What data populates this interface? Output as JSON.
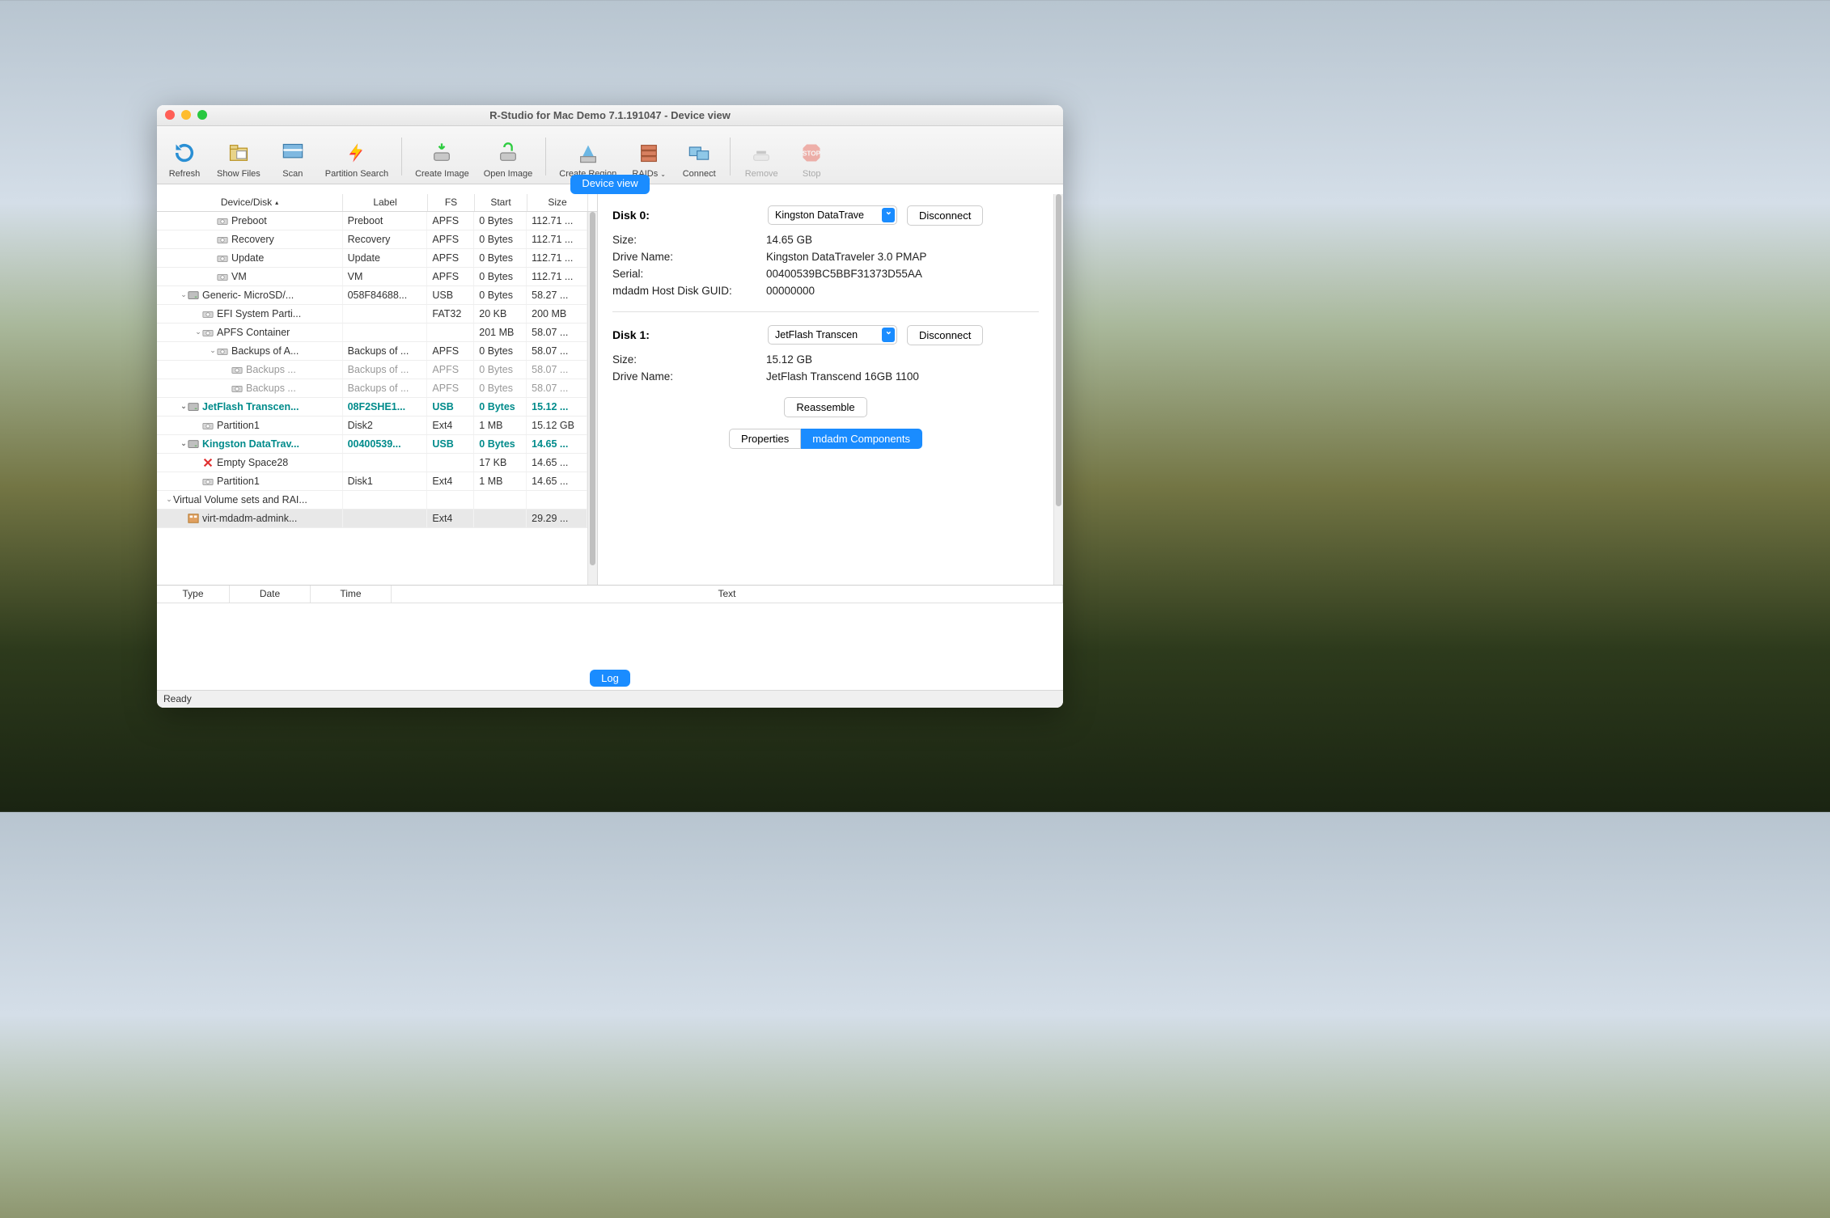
{
  "window": {
    "title": "R-Studio for Mac Demo 7.1.191047 - Device view"
  },
  "toolbar": [
    {
      "id": "refresh",
      "label": "Refresh",
      "icon": "refresh"
    },
    {
      "id": "showfiles",
      "label": "Show Files",
      "icon": "folder"
    },
    {
      "id": "scan",
      "label": "Scan",
      "icon": "scan"
    },
    {
      "id": "partsearch",
      "label": "Partition Search",
      "icon": "lightning"
    },
    {
      "id": "createimage",
      "label": "Create Image",
      "icon": "disk-arrow"
    },
    {
      "id": "openimage",
      "label": "Open Image",
      "icon": "disk-open"
    },
    {
      "id": "createregion",
      "label": "Create Region",
      "icon": "region"
    },
    {
      "id": "raids",
      "label": "RAIDs",
      "icon": "raid",
      "dropdown": true
    },
    {
      "id": "connect",
      "label": "Connect",
      "icon": "monitors"
    },
    {
      "id": "remove",
      "label": "Remove",
      "icon": "minus",
      "disabled": true
    },
    {
      "id": "stop",
      "label": "Stop",
      "icon": "stop",
      "disabled": true
    }
  ],
  "viewtab": "Device view",
  "cols": {
    "device": "Device/Disk",
    "label": "Label",
    "fs": "FS",
    "start": "Start",
    "size": "Size"
  },
  "rows": [
    {
      "indent": 3,
      "icon": "disk",
      "name": "Preboot",
      "label": "Preboot",
      "fs": "APFS",
      "start": "0 Bytes",
      "size": "112.71 ..."
    },
    {
      "indent": 3,
      "icon": "disk",
      "name": "Recovery",
      "label": "Recovery",
      "fs": "APFS",
      "start": "0 Bytes",
      "size": "112.71 ..."
    },
    {
      "indent": 3,
      "icon": "disk",
      "name": "Update",
      "label": "Update",
      "fs": "APFS",
      "start": "0 Bytes",
      "size": "112.71 ..."
    },
    {
      "indent": 3,
      "icon": "disk",
      "name": "VM",
      "label": "VM",
      "fs": "APFS",
      "start": "0 Bytes",
      "size": "112.71 ..."
    },
    {
      "indent": 1,
      "chev": "v",
      "icon": "drive",
      "name": "Generic- MicroSD/...",
      "label": "058F84688...",
      "fs": "USB",
      "start": "0 Bytes",
      "size": "58.27 ..."
    },
    {
      "indent": 2,
      "icon": "disk",
      "name": "EFI System Parti...",
      "label": "",
      "fs": "FAT32",
      "start": "20 KB",
      "size": "200 MB"
    },
    {
      "indent": 2,
      "chev": "v",
      "icon": "disk",
      "name": "APFS Container",
      "label": "",
      "fs": "",
      "start": "201 MB",
      "size": "58.07 ..."
    },
    {
      "indent": 3,
      "chev": "v",
      "icon": "disk",
      "name": "Backups of A...",
      "label": "Backups of ...",
      "fs": "APFS",
      "start": "0 Bytes",
      "size": "58.07 ..."
    },
    {
      "indent": 4,
      "icon": "disk",
      "dim": true,
      "name": "Backups ...",
      "label": "Backups of ...",
      "fs": "APFS",
      "start": "0 Bytes",
      "size": "58.07 ..."
    },
    {
      "indent": 4,
      "icon": "disk",
      "dim": true,
      "name": "Backups ...",
      "label": "Backups of ...",
      "fs": "APFS",
      "start": "0 Bytes",
      "size": "58.07 ..."
    },
    {
      "indent": 1,
      "chev": "v",
      "icon": "drive",
      "bold": true,
      "name": "JetFlash Transcen...",
      "label": "08F2SHE1...",
      "fs": "USB",
      "start": "0 Bytes",
      "size": "15.12 ..."
    },
    {
      "indent": 2,
      "icon": "disk",
      "name": "Partition1",
      "label": "Disk2",
      "fs": "Ext4",
      "start": "1 MB",
      "size": "15.12 GB"
    },
    {
      "indent": 1,
      "chev": "v",
      "icon": "drive",
      "bold": true,
      "name": "Kingston DataTrav...",
      "label": "00400539...",
      "fs": "USB",
      "start": "0 Bytes",
      "size": "14.65 ..."
    },
    {
      "indent": 2,
      "icon": "x",
      "name": "Empty Space28",
      "label": "",
      "fs": "",
      "start": "17 KB",
      "size": "14.65 ..."
    },
    {
      "indent": 2,
      "icon": "disk",
      "name": "Partition1",
      "label": "Disk1",
      "fs": "Ext4",
      "start": "1 MB",
      "size": "14.65 ..."
    },
    {
      "indent": 0,
      "chev": "v",
      "name": "Virtual Volume sets and RAI...",
      "label": "",
      "fs": "",
      "start": "",
      "size": ""
    },
    {
      "indent": 1,
      "icon": "raid-small",
      "name": "virt-mdadm-admink...",
      "label": "",
      "fs": "Ext4",
      "start": "",
      "size": "29.29 ...",
      "selected": true
    }
  ],
  "panel": {
    "disk0": {
      "title": "Disk 0:",
      "select": "Kingston DataTrave",
      "disconnect": "Disconnect",
      "props": [
        {
          "k": "Size:",
          "v": "14.65 GB"
        },
        {
          "k": "Drive Name:",
          "v": "Kingston DataTraveler 3.0 PMAP"
        },
        {
          "k": "Serial:",
          "v": "00400539BC5BBF31373D55AA"
        },
        {
          "k": "mdadm Host Disk GUID:",
          "v": "00000000"
        }
      ]
    },
    "disk1": {
      "title": "Disk 1:",
      "select": "JetFlash Transcen",
      "disconnect": "Disconnect",
      "props": [
        {
          "k": "Size:",
          "v": "15.12 GB"
        },
        {
          "k": "Drive Name:",
          "v": "JetFlash Transcend 16GB 1100"
        }
      ]
    },
    "reassemble": "Reassemble",
    "tabs": {
      "a": "Properties",
      "b": "mdadm Components",
      "active": "b"
    }
  },
  "log": {
    "cols": [
      "Type",
      "Date",
      "Time",
      "Text"
    ],
    "pill": "Log"
  },
  "status": "Ready"
}
